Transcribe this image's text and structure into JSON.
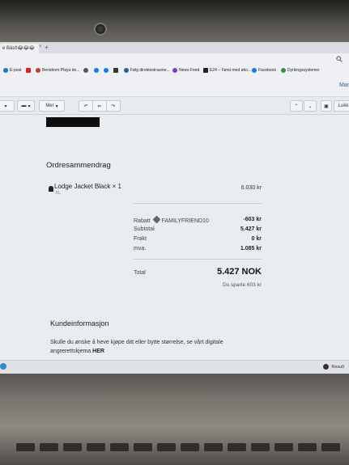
{
  "browser": {
    "tab_title": "e Bäst!😂😂😂",
    "tab_close": "×",
    "tab_new": "+",
    "addr_icon": "search-icon",
    "bookmarks": [
      {
        "label": "E-post",
        "icon": "mail-icon",
        "color": "#1e73c9"
      },
      {
        "label": "",
        "icon": "youtube-icon",
        "color": "#e02020"
      },
      {
        "label": "Benidorm Playa de...",
        "icon": "site-icon",
        "color": "#c63c2b"
      },
      {
        "label": "",
        "icon": "settings-icon",
        "color": "#555555"
      },
      {
        "label": "",
        "icon": "facebook-icon",
        "color": "#1877f2"
      },
      {
        "label": "",
        "icon": "facebook-icon",
        "color": "#1877f2"
      },
      {
        "label": "",
        "icon": "site-icon",
        "color": "#333333"
      },
      {
        "label": "Følg direktestraume...",
        "icon": "site-icon",
        "color": "#2b5ea8"
      },
      {
        "label": "News Feed",
        "icon": "site-icon",
        "color": "#7b3fbf"
      },
      {
        "label": "E24 – Først med øko...",
        "icon": "site-icon",
        "color": "#222222"
      },
      {
        "label": "Facebook",
        "icon": "facebook-icon",
        "color": "#1877f2"
      },
      {
        "label": "Dyrkingssystemer",
        "icon": "site-icon",
        "color": "#3a8f3a"
      }
    ]
  },
  "app": {
    "user_label": "Mar"
  },
  "toolbar": {
    "more_label": "Mer",
    "right_label": "Lukk"
  },
  "order": {
    "heading": "Ordresammendrag",
    "product_name": "Lodge Jacket Black × 1",
    "product_variant": "XL",
    "product_price": "6.030 kr",
    "discount_label": "Rabatt",
    "discount_code": "FAMILYFRIEND10",
    "discount_value": "-603 kr",
    "subtotal_label": "Subtotal",
    "subtotal_value": "5.427 kr",
    "shipping_label": "Frakt",
    "shipping_value": "0 kr",
    "vat_label": "mva.",
    "vat_value": "1.085 kr",
    "total_label": "Total",
    "total_value": "5.427 NOK",
    "saved_text": "Du sparte 603 kr"
  },
  "customer": {
    "heading": "Kundeinformasjon",
    "text": "Skulle du ønske å heve kjøpe ditt eller bytte størrelse, se vårt digitale angrerettskjema",
    "link": "HER"
  },
  "statusbar": {
    "right_label": "Result"
  }
}
